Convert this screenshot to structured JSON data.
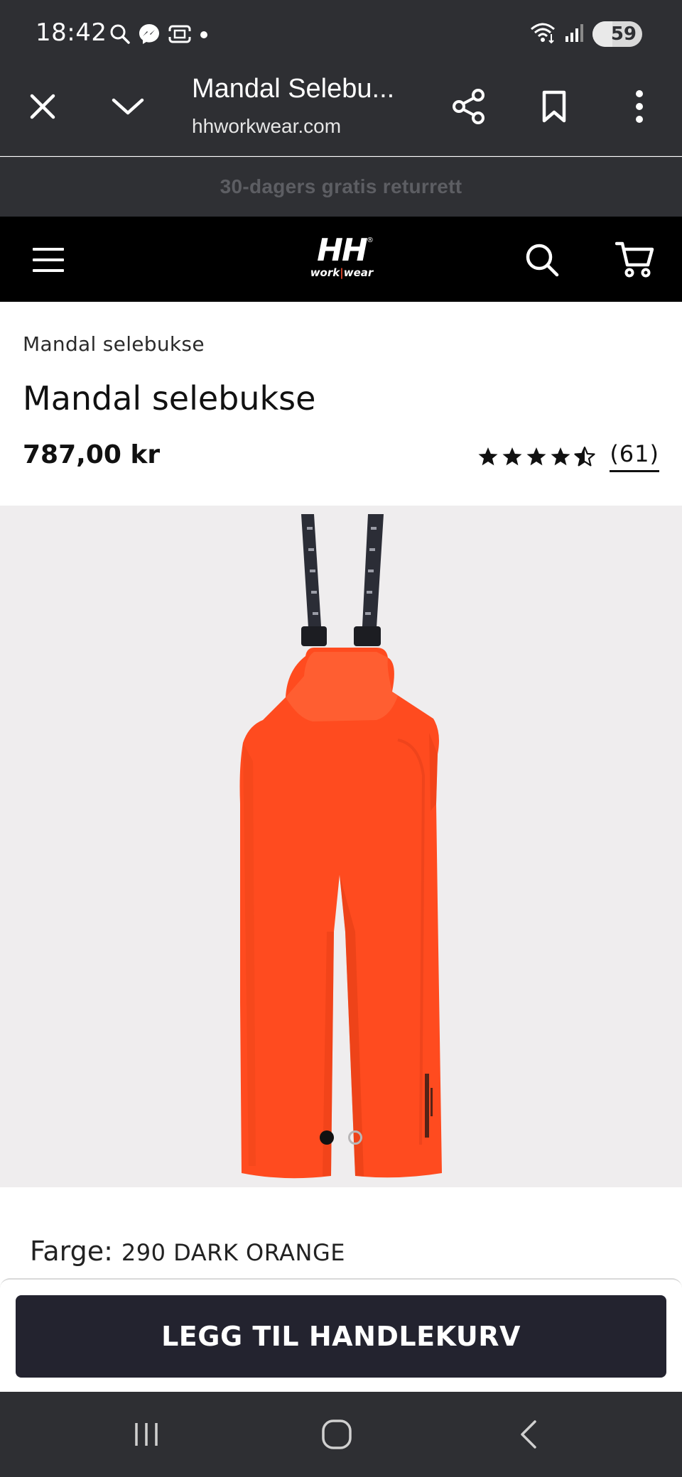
{
  "status_bar": {
    "time": "18:42",
    "battery": "59",
    "icons": [
      "search-icon",
      "messenger-icon",
      "screenshot-icon",
      "dot-icon",
      "wifi-icon",
      "signal-icon",
      "battery-icon"
    ]
  },
  "browser": {
    "page_title": "Mandal Selebu...",
    "url": "hhworkwear.com",
    "icons": [
      "close-icon",
      "chevron-down-icon",
      "share-icon",
      "bookmark-icon",
      "more-vert-icon"
    ]
  },
  "promo": {
    "text": "30-dagers gratis returrett"
  },
  "site_header": {
    "logo_main": "HH",
    "logo_reg": "®",
    "logo_sub_a": "work",
    "logo_sub_b": "wear",
    "icons": [
      "menu-icon",
      "search-icon",
      "cart-icon"
    ]
  },
  "product": {
    "breadcrumb": "Mandal selebukse",
    "title": "Mandal selebukse",
    "price": "787,00 kr",
    "rating": 4.5,
    "review_count": "(61)",
    "color_label": "Farge:",
    "color_value": "290 DARK ORANGE",
    "image_count": 2,
    "active_image": 1,
    "colors": {
      "product": "#ff4b1f",
      "strap": "#2b2d36",
      "gallery_bg": "#efedee"
    }
  },
  "cart": {
    "button_label": "LEGG TIL HANDLEKURV"
  },
  "nav_bar": {
    "icons": [
      "recents-icon",
      "home-icon",
      "back-icon"
    ]
  }
}
